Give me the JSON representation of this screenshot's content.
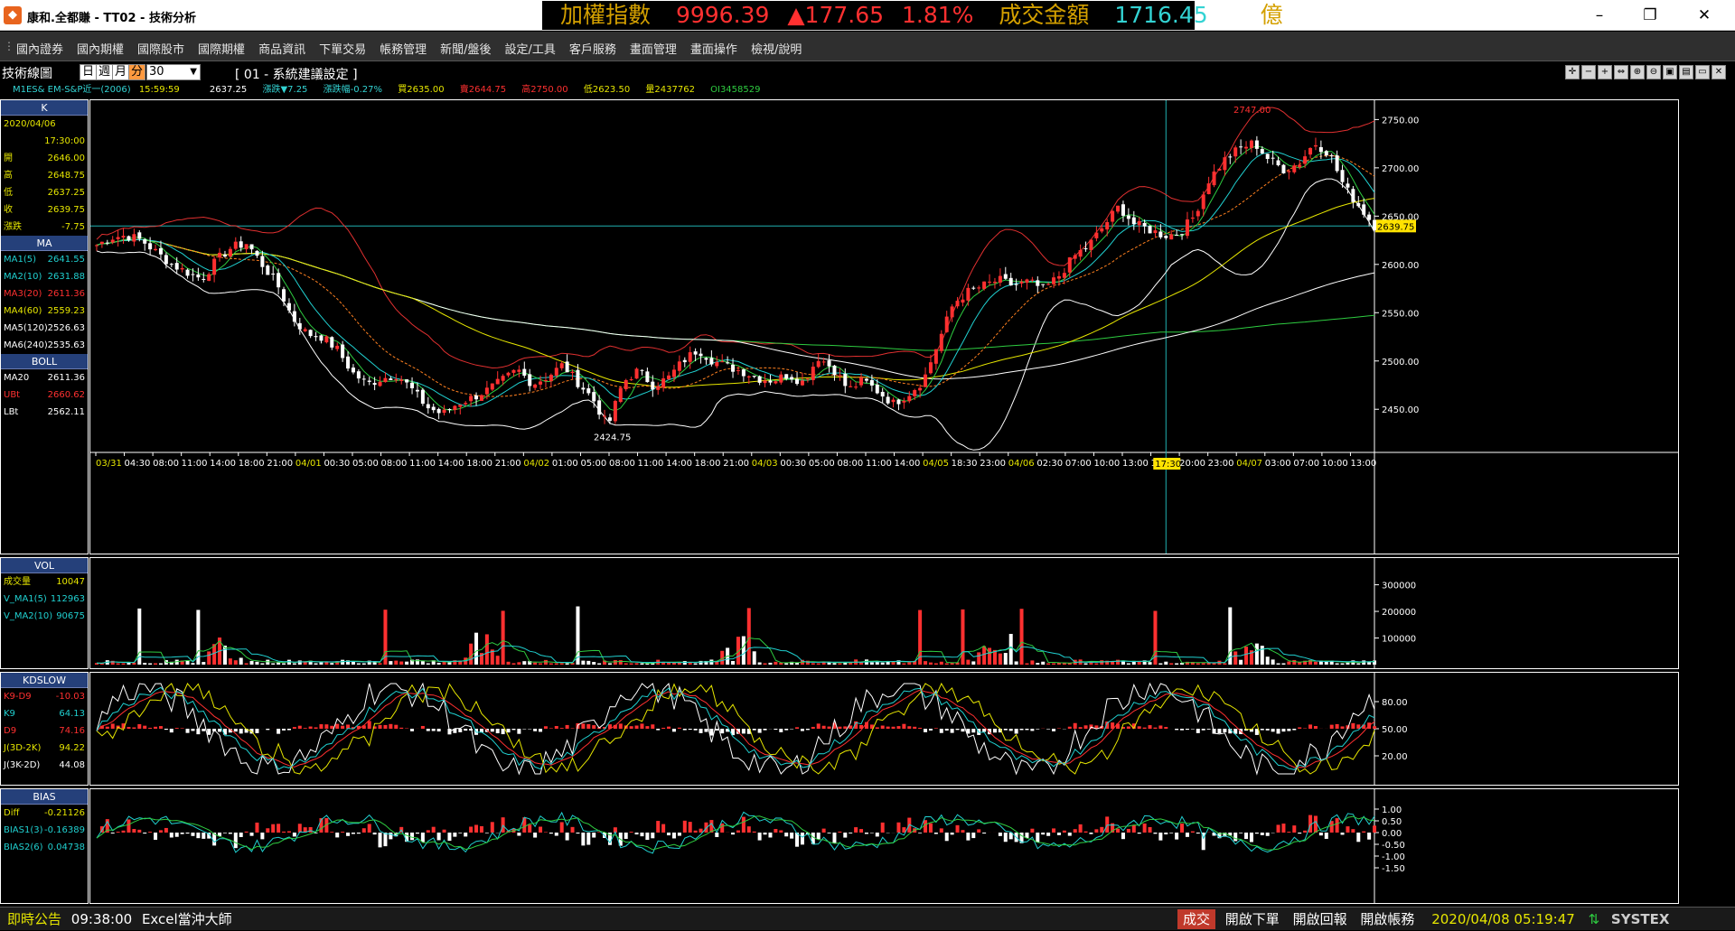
{
  "window": {
    "title": "康和.全都賺 - TT02 - 技術分析",
    "app_icon": "kanghe-logo-icon",
    "min_icon": "minimize-icon",
    "max_icon": "maximize-icon",
    "close_icon": "close-icon"
  },
  "ticker": {
    "index_label": "加權指數",
    "index_value": "9996.39",
    "change": "▲177.65",
    "change_pct": "1.81%",
    "turnover_label": "成交金額",
    "turnover_value": "1716.45",
    "turnover_unit": "億",
    "colors": {
      "label": "#d4a000",
      "up": "#ff3030",
      "value": "#33d3d3"
    }
  },
  "menu": {
    "items": [
      "國內證券",
      "國內期權",
      "國際股市",
      "國際期權",
      "商品資訊",
      "下單交易",
      "帳務管理",
      "新聞/盤後",
      "設定/工具",
      "客戶服務",
      "畫面管理",
      "畫面操作",
      "檢視/說明"
    ]
  },
  "toolbar": {
    "label": "技術線圖",
    "period_tabs": [
      "日",
      "週",
      "月",
      "分"
    ],
    "active_tab": "分",
    "interval_value": "30",
    "template_name": "[ 01 - 系統建議設定 ]",
    "tool_icons": [
      "crosshair-icon",
      "minus-icon",
      "plus-icon",
      "scroll-icon",
      "zoom-in-icon",
      "zoom-out-icon",
      "save-icon",
      "print-icon",
      "window-icon",
      "close-icon"
    ]
  },
  "quote_line": {
    "symbol": "M1ES&  EM-S&P近一(2006)",
    "time": "15:59:59",
    "last": "2637.25",
    "change": "漲跌▼7.25",
    "change_pct": "漲跌幅-0.27%",
    "bid": "買2635.00",
    "ask": "賣2644.75",
    "high": "高2750.00",
    "low": "低2623.50",
    "volume": "量2437762",
    "oi": "OI3458529"
  },
  "side_k": {
    "header": "K",
    "date": "2020/04/06",
    "time": "17:30:00",
    "rows": [
      {
        "k": "開",
        "v": "2646.00"
      },
      {
        "k": "高",
        "v": "2648.75"
      },
      {
        "k": "低",
        "v": "2637.25"
      },
      {
        "k": "收",
        "v": "2639.75"
      },
      {
        "k": "漲跌",
        "v": "-7.75"
      }
    ],
    "ma_header": "MA",
    "ma_rows": [
      {
        "k": "MA1(5)",
        "v": "2641.55",
        "c": "#20d0d0"
      },
      {
        "k": "MA2(10)",
        "v": "2631.88",
        "c": "#20d0d0"
      },
      {
        "k": "MA3(20)",
        "v": "2611.36",
        "c": "#ff3030"
      },
      {
        "k": "MA4(60)",
        "v": "2559.23",
        "c": "#e6e600"
      },
      {
        "k": "MA5(120)",
        "v": "2526.63",
        "c": "#ffffff"
      },
      {
        "k": "MA6(240)",
        "v": "2535.63",
        "c": "#ffffff"
      }
    ],
    "boll_header": "BOLL",
    "boll_rows": [
      {
        "k": "MA20",
        "v": "2611.36",
        "c": "#ffffff"
      },
      {
        "k": "UBt",
        "v": "2660.62",
        "c": "#ff3030"
      },
      {
        "k": "LBt",
        "v": "2562.11",
        "c": "#ffffff"
      }
    ]
  },
  "side_vol": {
    "header": "VOL",
    "rows": [
      {
        "k": "成交量",
        "v": "10047",
        "c": "#e6e600"
      },
      {
        "k": "V_MA1(5)",
        "v": "112963",
        "c": "#20d0d0"
      },
      {
        "k": "V_MA2(10)",
        "v": "90675",
        "c": "#20d0d0"
      }
    ]
  },
  "side_kd": {
    "header": "KDSLOW",
    "rows": [
      {
        "k": "K9-D9",
        "v": "-10.03",
        "c": "#ff3030"
      },
      {
        "k": "K9",
        "v": "64.13",
        "c": "#20d0d0"
      },
      {
        "k": "D9",
        "v": "74.16",
        "c": "#ff3030"
      },
      {
        "k": "J(3D-2K)",
        "v": "94.22",
        "c": "#e6e600"
      },
      {
        "k": "J(3K-2D)",
        "v": "44.08",
        "c": "#ffffff"
      }
    ]
  },
  "side_bias": {
    "header": "BIAS",
    "rows": [
      {
        "k": "Diff",
        "v": "-0.21126",
        "c": "#e6e600"
      },
      {
        "k": "BIAS1(3)",
        "v": "-0.16389",
        "c": "#20d0d0"
      },
      {
        "k": "BIAS2(6)",
        "v": "0.04738",
        "c": "#20d0d0"
      }
    ]
  },
  "chart_data": {
    "type": "candlestick",
    "price_axis": {
      "ticks": [
        "2750.00",
        "2700.00",
        "2650.00",
        "2600.00",
        "2550.00",
        "2500.00",
        "2450.00"
      ],
      "range": [
        2410,
        2770
      ]
    },
    "current_price_label": "2639.75",
    "reference_price": 2639.75,
    "annotations": [
      {
        "text": "2747.00",
        "type": "high-marker"
      },
      {
        "text": "2424.75",
        "type": "low-marker"
      }
    ],
    "time_labels": [
      "03/31",
      "04:30",
      "08:00",
      "11:00",
      "14:00",
      "18:00",
      "21:00",
      "04/01",
      "00:30",
      "05:00",
      "08:00",
      "11:00",
      "14:00",
      "18:00",
      "21:00",
      "04/02",
      "01:00",
      "05:00",
      "08:00",
      "11:00",
      "14:00",
      "18:00",
      "21:00",
      "04/03",
      "00:30",
      "05:00",
      "08:00",
      "11:00",
      "14:00",
      "04/05",
      "18:30",
      "23:00",
      "04/06",
      "02:30",
      "07:00",
      "10:00",
      "13:00",
      "17:30",
      "20:00",
      "23:00",
      "04/07",
      "03:00",
      "07:00",
      "10:00",
      "13:00"
    ],
    "close_path": [
      2620,
      2628,
      2630,
      2625,
      2612,
      2600,
      2592,
      2585,
      2605,
      2618,
      2622,
      2600,
      2580,
      2545,
      2528,
      2525,
      2512,
      2488,
      2476,
      2482,
      2486,
      2470,
      2452,
      2445,
      2456,
      2462,
      2470,
      2480,
      2491,
      2476,
      2484,
      2496,
      2478,
      2461,
      2432,
      2478,
      2490,
      2475,
      2482,
      2500,
      2512,
      2500,
      2494,
      2489,
      2482,
      2480,
      2486,
      2478,
      2504,
      2492,
      2470,
      2480,
      2468,
      2456,
      2466,
      2480,
      2520,
      2560,
      2572,
      2578,
      2584,
      2578,
      2582,
      2574,
      2588,
      2608,
      2620,
      2640,
      2660,
      2642,
      2636,
      2630,
      2632,
      2650,
      2688,
      2708,
      2720,
      2726,
      2708,
      2698,
      2705,
      2726,
      2715,
      2680,
      2660,
      2640
    ],
    "volume_axis": [
      "300000",
      "200000",
      "100000"
    ],
    "kd_axis": [
      "80.00",
      "50.00",
      "20.00"
    ],
    "bias_axis": [
      "1.00",
      "0.50",
      "0.00",
      "-0.50",
      "-1.00",
      "-1.50"
    ],
    "series_colors": {
      "up": "#ff3030",
      "down": "#ffffff",
      "ma5": "#20d0d0",
      "ma10": "#20d0d0",
      "ma20": "#ff3030",
      "ma60": "#e6e600",
      "ma120": "#ffffff",
      "ma240": "#2ecc40",
      "boll_ub": "#e03030",
      "boll_lb": "#ffffff"
    }
  },
  "crosshair_time": "17:30",
  "status": {
    "announce_label": "即時公告",
    "announce_time": "09:38:00",
    "announce_text": "Excel當沖大師",
    "buttons": [
      "成交",
      "開啟下單",
      "開啟回報",
      "開啟帳務"
    ],
    "datetime": "2020/04/08 05:19:47",
    "brand": "SYSTEX"
  }
}
